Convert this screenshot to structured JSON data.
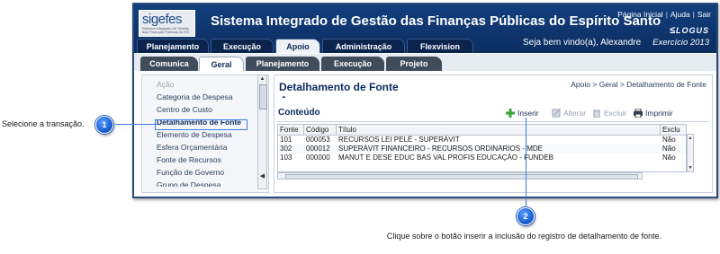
{
  "app": {
    "logo_text": "sigefes",
    "logo_subtext": "Sistema Integrado de Gestão das Finanças Públicas do ES",
    "title": "Sistema Integrado de Gestão das Finanças Públicas do Espírito Santo",
    "top_links": [
      "Página Inicial",
      "Ajuda",
      "Sair"
    ],
    "brand": "LOGUS",
    "welcome": "Seja bem vindo(a), Alexandre",
    "exercise": "Exercício 2013"
  },
  "main_tabs": [
    "Planejamento",
    "Execução",
    "Apoio",
    "Administração",
    "Flexvision"
  ],
  "main_tab_active": "Apoio",
  "sub_tabs": [
    "Comunica",
    "Geral",
    "Planejamento",
    "Execução",
    "Projeto"
  ],
  "sub_tab_active": "Geral",
  "sidebar": {
    "items": [
      {
        "label": "Ação",
        "state": "disabled"
      },
      {
        "label": "Categoria de Despesa",
        "state": "normal"
      },
      {
        "label": "Centro de Custo",
        "state": "normal"
      },
      {
        "label": "Detalhamento de Fonte",
        "state": "selected"
      },
      {
        "label": "Elemento de Despesa",
        "state": "normal"
      },
      {
        "label": "Esfera Orçamentária",
        "state": "normal"
      },
      {
        "label": "Fonte de Recursos",
        "state": "normal"
      },
      {
        "label": "Função de Governo",
        "state": "normal"
      },
      {
        "label": "Grupo de Despesa",
        "state": "normal"
      }
    ]
  },
  "page": {
    "title": "Detalhamento de Fonte",
    "breadcrumb": "Apoio > Geral > Detalhamento de Fonte",
    "collapse_symbol": "⌃",
    "section_title": "Conteúdo"
  },
  "toolbar": {
    "insert": "Inserir",
    "edit": "Alterar",
    "delete": "Excluir",
    "print": "Imprimir"
  },
  "grid": {
    "columns": [
      "Fonte",
      "Código",
      "Título",
      "Exclu"
    ],
    "rows": [
      [
        "101",
        "000053",
        "RECURSOS LEI PELÉ - SUPERÁVIT",
        "Não"
      ],
      [
        "302",
        "000012",
        "SUPERÁVIT FINANCEIRO - RECURSOS ORDINÁRIOS - MDE",
        "Não"
      ],
      [
        "103",
        "000000",
        "MANUT E DESE EDUC BAS VAL PROFIS EDUCAÇÃO - FUNDEB",
        "Não"
      ]
    ]
  },
  "callouts": [
    {
      "number": "1",
      "text": "Selecione a transação."
    },
    {
      "number": "2",
      "text": "Clique sobre o botão inserir a inclusão do registro de detalhamento de fonte."
    }
  ],
  "colors": {
    "header_navy": "#0c2f63",
    "callout_blue": "#1a5fd0",
    "insert_green": "#3aa63a"
  }
}
